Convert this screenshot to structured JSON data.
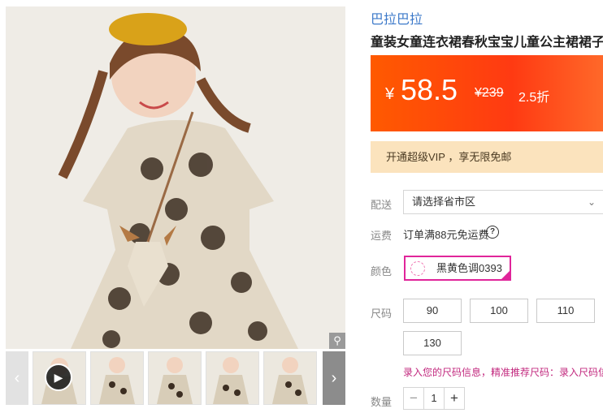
{
  "gallery": {
    "zoom_icon": "magnifier-icon",
    "play_icon": "play-icon",
    "prev_icon": "chevron-left-icon",
    "next_icon": "chevron-right-icon",
    "thumb_count": 6
  },
  "product": {
    "brand": "巴拉巴拉",
    "title": "童装女童连衣裙春秋宝宝儿童公主裙裙子",
    "currency": "¥",
    "price": "58.5",
    "original_price": "¥239",
    "discount": "2.5折",
    "vip_text": "开通超级VIP ，享无限免邮"
  },
  "delivery": {
    "label": "配送",
    "placeholder": "请选择省市区"
  },
  "shipping": {
    "label": "运费",
    "text": "订单满88元免运费",
    "help": "?"
  },
  "color": {
    "label": "颜色",
    "selected": "黑黄色调0393",
    "accent": "#e0259a"
  },
  "size": {
    "label": "尺码",
    "options": [
      "90",
      "100",
      "110",
      "130"
    ],
    "tip": "录入您的尺码信息，精准推荐尺码：录入尺码信"
  },
  "quantity": {
    "label": "数量",
    "value": "1",
    "minus": "−",
    "plus": "+"
  },
  "colors": {
    "price_bg": "#ff4a10",
    "vip_bg": "#fbe3bd",
    "brand_link": "#3b78c9"
  }
}
